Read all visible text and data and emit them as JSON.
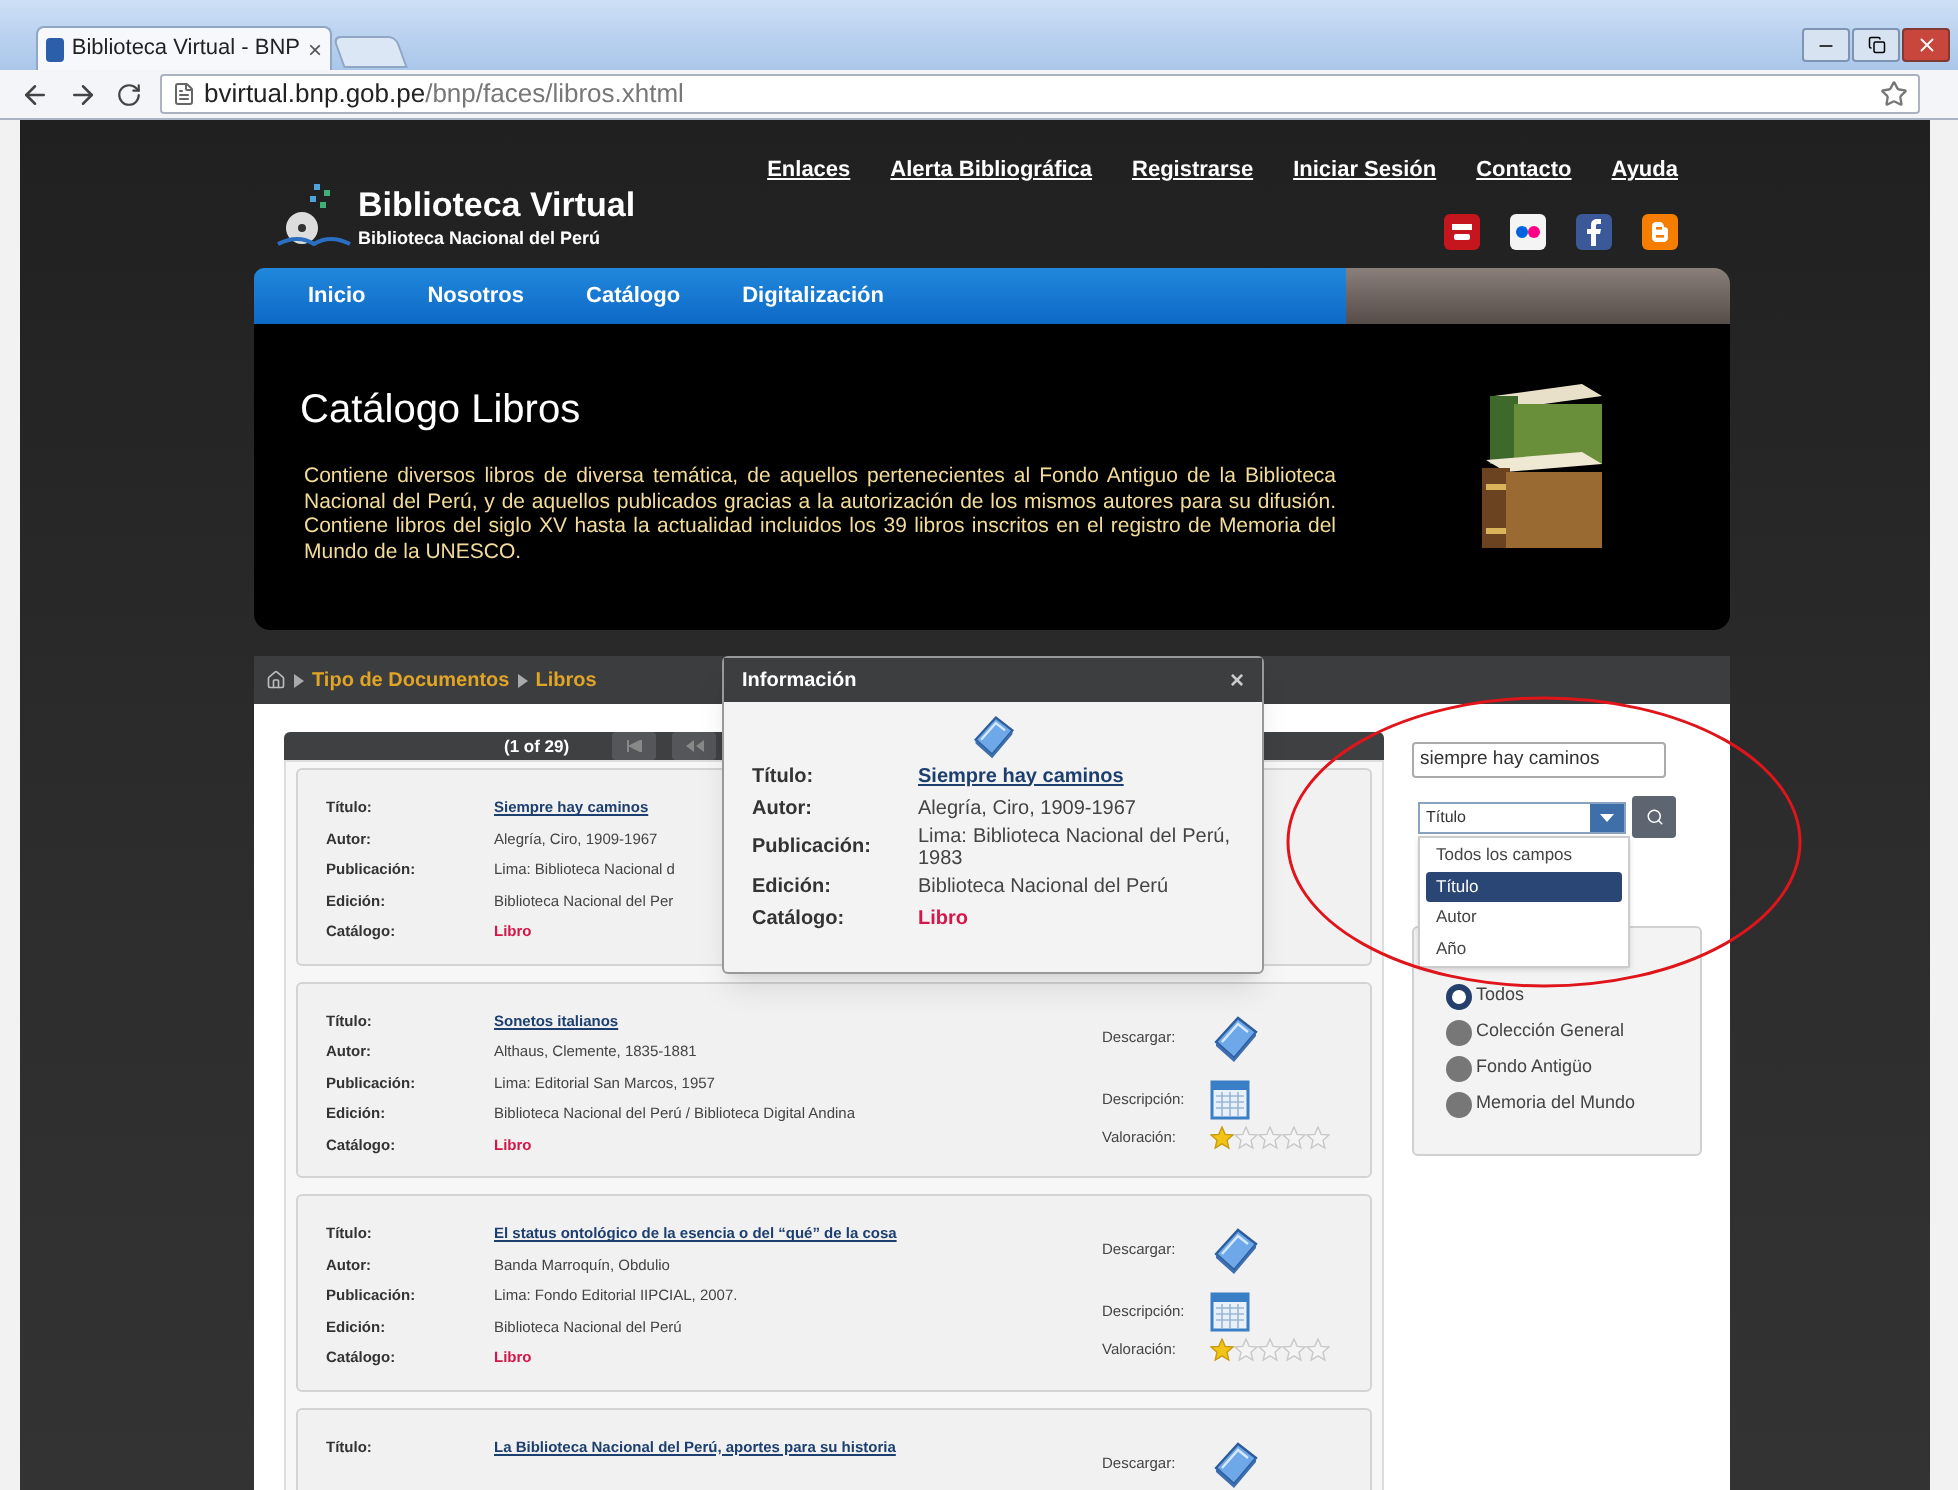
{
  "browser": {
    "tab": {
      "title": "Biblioteca Virtual - BNP",
      "close": "×"
    },
    "url": {
      "host": "bvirtual.bnp.gob.pe",
      "path": "/bnp/faces/libros.xhtml"
    }
  },
  "header": {
    "top_links": [
      "Enlaces",
      "Alerta Bibliográfica",
      "Registrarse",
      "Iniciar Sesión",
      "Contacto",
      "Ayuda"
    ],
    "logo": {
      "title": "Biblioteca Virtual",
      "subtitle": "Biblioteca Nacional del Perú"
    },
    "social": [
      {
        "kind": "youtube"
      },
      {
        "kind": "flickr"
      },
      {
        "kind": "facebook"
      },
      {
        "kind": "blogger"
      }
    ]
  },
  "nav": [
    "Inicio",
    "Nosotros",
    "Catálogo",
    "Digitalización"
  ],
  "banner": {
    "title": "Catálogo Libros",
    "description": "Contiene diversos libros de diversa temática, de aquellos pertenecientes al Fondo Antiguo de la Biblioteca Nacional del Perú, y de aquellos publicados gracias a la autorización de los mismos autores para su difusión. Contiene libros del siglo XV hasta la actualidad incluidos los 39 libros inscritos en el registro de Memoria del Mundo de la UNESCO."
  },
  "breadcrumb": [
    "Tipo de Documentos",
    "Libros"
  ],
  "paginator": {
    "label": "(1 of 29)"
  },
  "results": [
    {
      "fields": [
        {
          "label": "Título:",
          "value": "Siempre hay caminos",
          "kind": "link"
        },
        {
          "label": "Autor:",
          "value": "Alegría, Ciro, 1909-1967",
          "kind": "text"
        },
        {
          "label": "Publicación:",
          "value": "Lima: Biblioteca Nacional d",
          "kind": "text"
        },
        {
          "label": "Edición:",
          "value": "Biblioteca Nacional del Per",
          "kind": "text"
        },
        {
          "label": "Catálogo:",
          "value": "Libro",
          "kind": "catalog"
        }
      ]
    },
    {
      "fields": [
        {
          "label": "Título:",
          "value": "Sonetos italianos",
          "kind": "link"
        },
        {
          "label": "Autor:",
          "value": "Althaus, Clemente, 1835-1881",
          "kind": "text"
        },
        {
          "label": "Publicación:",
          "value": "Lima: Editorial San Marcos, 1957",
          "kind": "text"
        },
        {
          "label": "Edición:",
          "value": "Biblioteca Nacional del Perú / Biblioteca Digital Andina",
          "kind": "text"
        },
        {
          "label": "Catálogo:",
          "value": "Libro",
          "kind": "catalog"
        }
      ],
      "actions": [
        {
          "label": "Descargar:",
          "kind": "download"
        },
        {
          "label": "Descripción:",
          "kind": "description"
        },
        {
          "label": "Valoración:",
          "kind": "rating",
          "stars": 1
        }
      ]
    },
    {
      "fields": [
        {
          "label": "Título:",
          "value": "El status ontológico de la esencia o del “qué” de la cosa",
          "kind": "link"
        },
        {
          "label": "Autor:",
          "value": "Banda Marroquín, Obdulio",
          "kind": "text"
        },
        {
          "label": "Publicación:",
          "value": "Lima: Fondo Editorial IIPCIAL, 2007.",
          "kind": "text"
        },
        {
          "label": "Edición:",
          "value": "Biblioteca Nacional del Perú",
          "kind": "text"
        },
        {
          "label": "Catálogo:",
          "value": "Libro",
          "kind": "catalog"
        }
      ],
      "actions": [
        {
          "label": "Descargar:",
          "kind": "download"
        },
        {
          "label": "Descripción:",
          "kind": "description"
        },
        {
          "label": "Valoración:",
          "kind": "rating",
          "stars": 1
        }
      ]
    },
    {
      "fields": [
        {
          "label": "Título:",
          "value": "La Biblioteca Nacional del Perú, aportes para su historia",
          "kind": "link"
        }
      ],
      "actions": [
        {
          "label": "Descargar:",
          "kind": "download"
        }
      ]
    }
  ],
  "search": {
    "value": "siempre hay caminos",
    "field": {
      "value": "Título",
      "options": [
        {
          "label": "Todos los campos",
          "selected": false
        },
        {
          "label": "Título",
          "selected": true
        },
        {
          "label": "Autor",
          "selected": false
        },
        {
          "label": "Año",
          "selected": false
        }
      ]
    }
  },
  "collections": [
    {
      "label": "Todos",
      "selected": true
    },
    {
      "label": "Colección General",
      "selected": false
    },
    {
      "label": "Fondo Antigüo",
      "selected": false
    },
    {
      "label": "Memoria del Mundo",
      "selected": false
    }
  ],
  "popup": {
    "title": "Información",
    "close": "×",
    "fields": [
      {
        "label": "Título:",
        "value": "Siempre hay caminos",
        "kind": "link"
      },
      {
        "label": "Autor:",
        "value": "Alegría, Ciro, 1909-1967",
        "kind": "text"
      },
      {
        "label": "Publicación:",
        "value": "Lima: Biblioteca Nacional del Perú, 1983",
        "kind": "text"
      },
      {
        "label": "Edición:",
        "value": "Biblioteca Nacional del Perú",
        "kind": "text"
      },
      {
        "label": "Catálogo:",
        "value": "Libro",
        "kind": "catalog"
      }
    ]
  }
}
